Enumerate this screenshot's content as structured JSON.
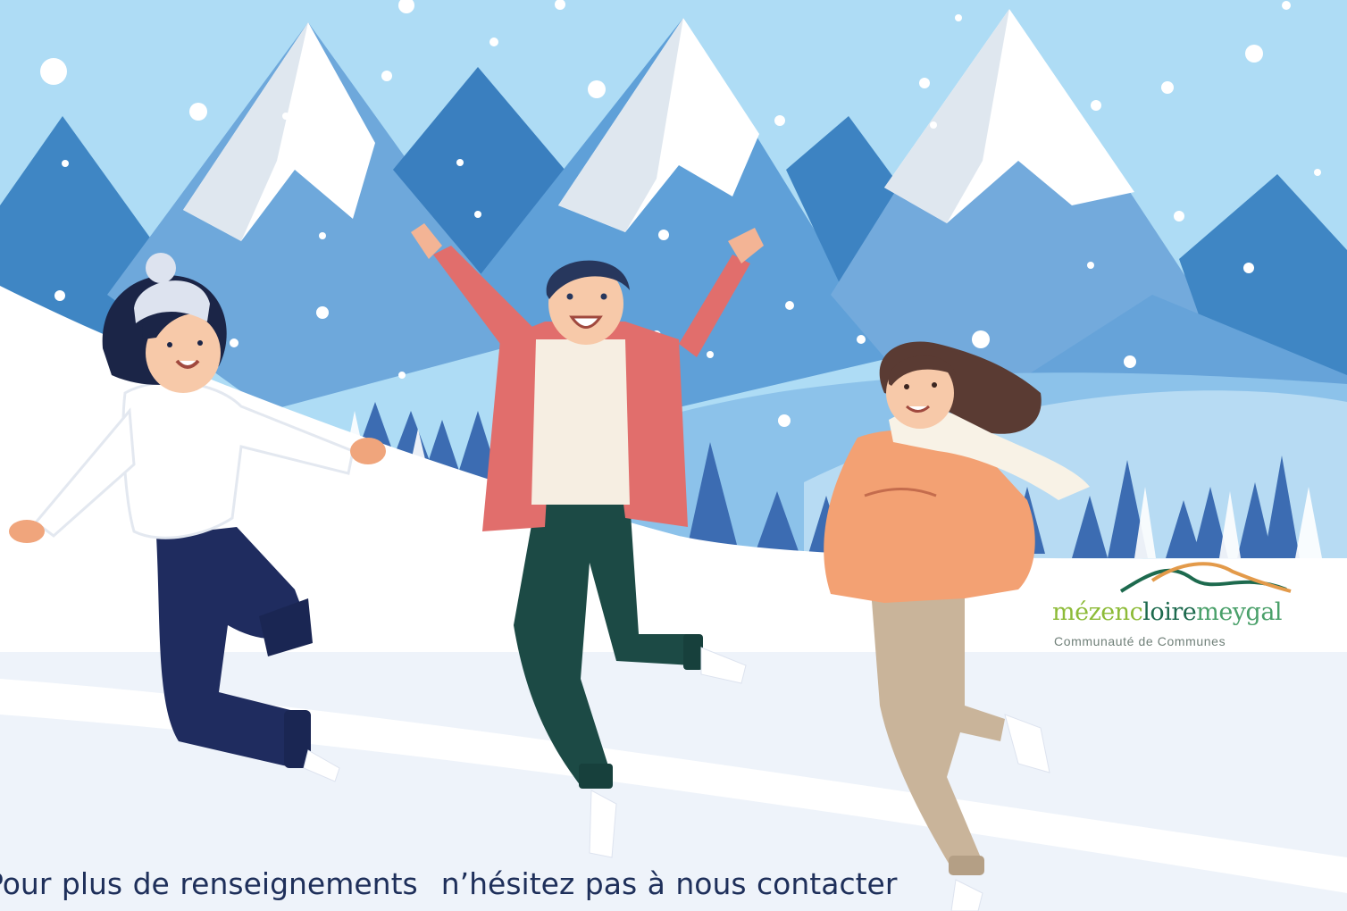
{
  "logo": {
    "word_part1": "mézenc",
    "word_part2": "loire",
    "word_part3": "meygal",
    "subtitle": "Communauté de Communes"
  },
  "footer": {
    "part1": "Pour plus de renseignements",
    "part2": "n’hésitez pas à nous contacter"
  },
  "colors": {
    "sky": "#aedcf5",
    "mountain_dark": "#3f82c2",
    "mountain_mid": "#6aa8dc",
    "snow": "#ffffff",
    "pine": "#3f6fb4",
    "jacket_red": "#e16e6c",
    "sweater_orange": "#f3a173",
    "pants_navy": "#1f2c5f",
    "pants_green": "#1c4a45",
    "pants_beige": "#c9b49a",
    "text_navy": "#1e2f5a"
  }
}
